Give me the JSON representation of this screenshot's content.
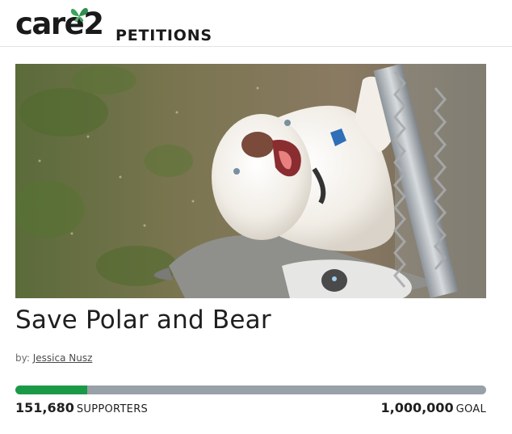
{
  "header": {
    "logo_word": "care",
    "logo_number": "2",
    "section_label": "PETITIONS",
    "butterfly_color": "#3ea35f"
  },
  "petition": {
    "title": "Save Polar and Bear",
    "by_prefix": "by:",
    "author": "Jessica Nusz",
    "image_subject": "white husky puppy and gray husky puppy by chain-link fence"
  },
  "progress": {
    "supporters_count": "151,680",
    "supporters_label": "SUPPORTERS",
    "goal_count": "1,000,000",
    "goal_label": "GOAL",
    "fill_fraction": 0.152,
    "fill_color": "#1a9a48",
    "track_color": "#98a0a8"
  }
}
